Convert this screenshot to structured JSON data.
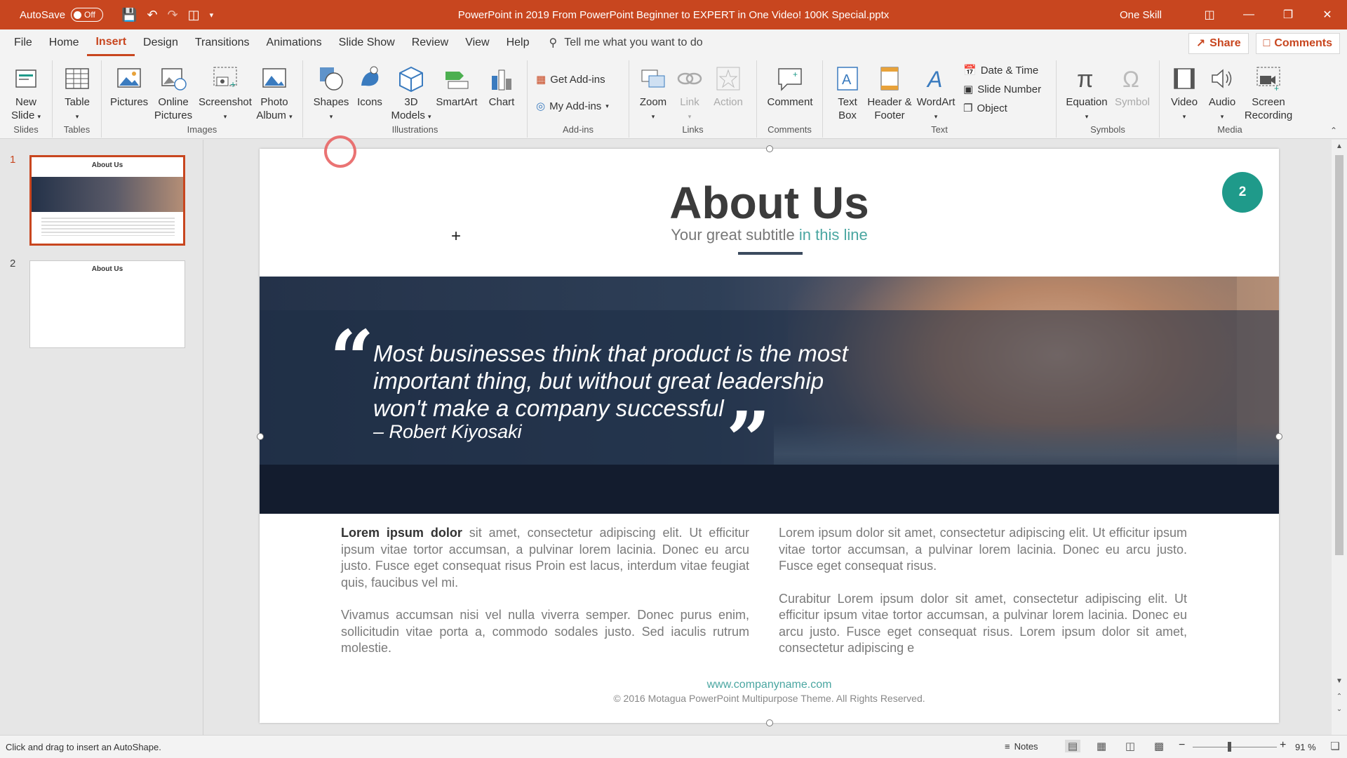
{
  "titlebar": {
    "autosave_label": "AutoSave",
    "autosave_state": "Off",
    "doc_title": "PowerPoint in 2019 From PowerPoint Beginner to EXPERT in One Video! 100K Special.pptx",
    "user": "One Skill"
  },
  "tabs": [
    "File",
    "Home",
    "Insert",
    "Design",
    "Transitions",
    "Animations",
    "Slide Show",
    "Review",
    "View",
    "Help"
  ],
  "active_tab": "Insert",
  "tell_me": "Tell me what you want to do",
  "share_label": "Share",
  "comments_label": "Comments",
  "ribbon": {
    "slides": {
      "label": "Slides",
      "new_slide": "New Slide"
    },
    "tables": {
      "label": "Tables",
      "table": "Table"
    },
    "images": {
      "label": "Images",
      "pictures": "Pictures",
      "online_pictures": "Online Pictures",
      "screenshot": "Screenshot",
      "photo_album": "Photo Album"
    },
    "illustrations": {
      "label": "Illustrations",
      "shapes": "Shapes",
      "icons": "Icons",
      "models3d": "3D Models",
      "smartart": "SmartArt",
      "chart": "Chart"
    },
    "addins": {
      "label": "Add-ins",
      "get": "Get Add-ins",
      "my": "My Add-ins"
    },
    "links": {
      "label": "Links",
      "zoom": "Zoom",
      "link": "Link",
      "action": "Action"
    },
    "comments": {
      "label": "Comments",
      "comment": "Comment"
    },
    "text": {
      "label": "Text",
      "textbox": "Text Box",
      "header_footer": "Header & Footer",
      "wordart": "WordArt",
      "date_time": "Date & Time",
      "slide_number": "Slide Number",
      "object": "Object"
    },
    "symbols": {
      "label": "Symbols",
      "equation": "Equation",
      "symbol": "Symbol"
    },
    "media": {
      "label": "Media",
      "video": "Video",
      "audio": "Audio",
      "screen_recording": "Screen Recording"
    }
  },
  "thumbnails": [
    {
      "number": "1",
      "title": "About Us"
    },
    {
      "number": "2",
      "title": "About Us"
    }
  ],
  "slide": {
    "title": "About Us",
    "subtitle_main": "Your great subtitle ",
    "subtitle_accent": "in this line",
    "badge": "2",
    "quote": "Most businesses think that product is the most important thing, but without great leadership won't make a company successful",
    "author": "– Robert Kiyosaki",
    "col1_bold": "Lorem ipsum dolor",
    "col1_p1": " sit amet, consectetur adipiscing elit. Ut efficitur ipsum vitae tortor accumsan, a pulvinar lorem lacinia. Donec eu arcu justo. Fusce eget consequat risus Proin est lacus, interdum vitae feugiat quis, faucibus vel mi.",
    "col1_p2": "Vivamus accumsan nisi vel nulla viverra semper. Donec purus enim, sollicitudin vitae porta a, commodo sodales justo. Sed iaculis rutrum molestie.",
    "col2_p1": "Lorem ipsum dolor sit amet, consectetur adipiscing elit. Ut efficitur ipsum vitae tortor accumsan, a pulvinar lorem lacinia. Donec eu arcu justo. Fusce eget consequat risus.",
    "col2_p2": "Curabitur Lorem ipsum dolor sit amet, consectetur adipiscing elit. Ut efficitur ipsum vitae tortor accumsan, a pulvinar lorem lacinia. Donec eu arcu justo. Fusce eget consequat risus. Lorem ipsum dolor sit amet, consectetur adipiscing e",
    "url": "www.companyname.com",
    "copyright": "© 2016 Motagua PowerPoint Multipurpose Theme. All Rights Reserved."
  },
  "status": {
    "message": "Click and drag to insert an AutoShape.",
    "notes": "Notes",
    "zoom": "91 %"
  },
  "colors": {
    "accent": "#c8461f",
    "teal": "#1f9a8a"
  }
}
